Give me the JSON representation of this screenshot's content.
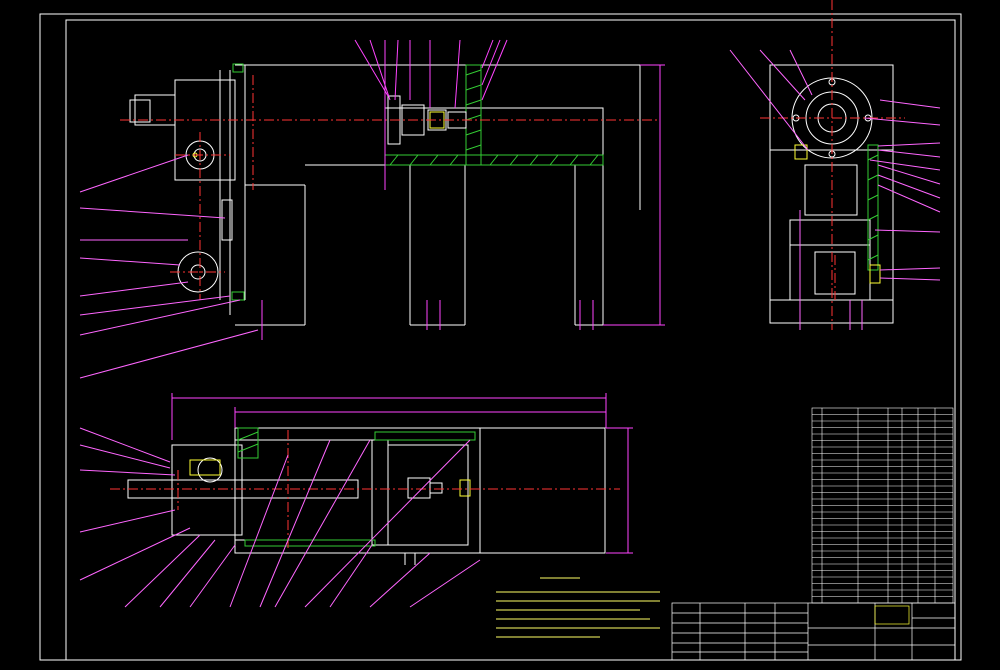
{
  "drawing": {
    "title_block_text": "",
    "drawing_number": "",
    "colors": {
      "background": "#000000",
      "frame": "#ffffff",
      "outline": "#ffffff",
      "dimension": "#ff44ff",
      "center": "#ff3333",
      "section": "#33cc33",
      "hidden": "#ffff33",
      "leader": "#ff66ff"
    }
  },
  "notes": {
    "heading": "",
    "lines": []
  },
  "parts_list": {
    "rows": []
  }
}
